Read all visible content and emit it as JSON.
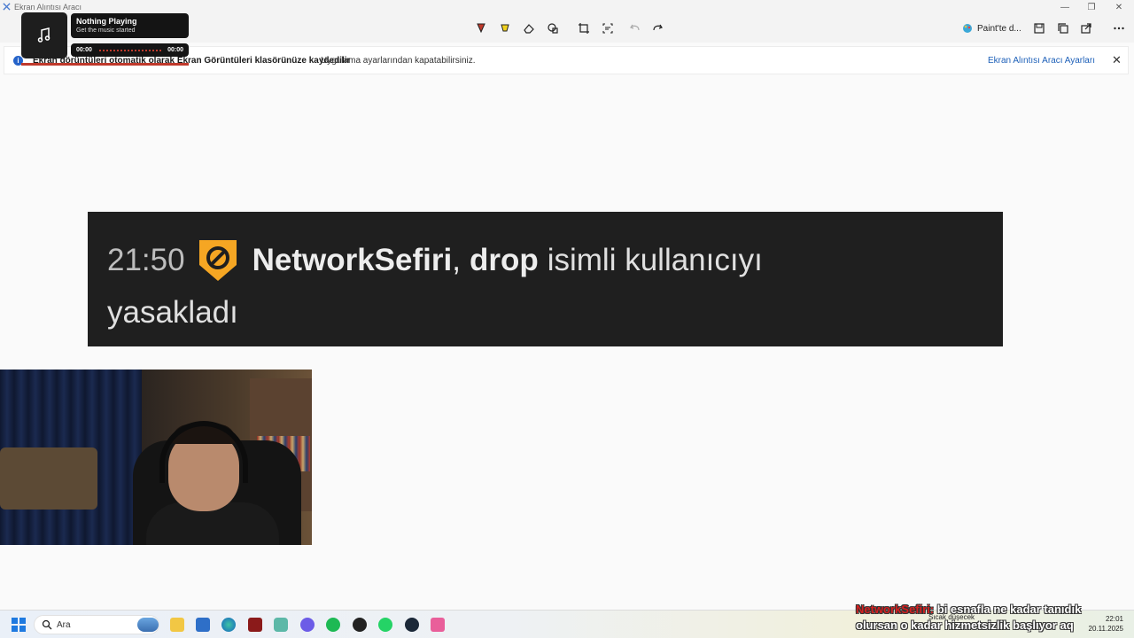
{
  "window": {
    "title": "Ekran Alıntısı Aracı",
    "controls": [
      "—",
      "❐",
      "✕"
    ]
  },
  "toolbar": {
    "tools": [
      "pen-icon",
      "highlighter-icon",
      "eraser-icon",
      "shapes-icon",
      "crop-icon",
      "text-actions-icon",
      "undo-icon",
      "redo-icon"
    ],
    "paint_label": "Paint'te d...",
    "actions": [
      "save-icon",
      "copy-icon",
      "share-icon",
      "more-icon"
    ]
  },
  "infobar": {
    "bold_text": "Ekran görüntüleri otomatik olarak Ekran Görüntüleri klasörünüze kaydedilir",
    "text": "Uygulama ayarlarından kapatabilirsiniz.",
    "link": "Ekran Alıntısı Aracı Ayarları",
    "close": "✕"
  },
  "music": {
    "title": "Nothing Playing",
    "subtitle": "Get the music started",
    "time_start": "00:00",
    "time_end": "00:00",
    "icon": "music-note-icon"
  },
  "chat_snippet": {
    "time": "21:50",
    "moderator": "NetworkSefiri",
    "comma": ",",
    "target": "drop",
    "message": "isimli kullanıcıyı",
    "message2": "yasakladı",
    "badge_color": "#f5a623"
  },
  "taskbar": {
    "search_placeholder": "Ara",
    "weather": "Sıcak düşecek",
    "clock_time": "22:01",
    "clock_date": "20.11.2025",
    "apps": [
      "weather-icon",
      "file-explorer-icon",
      "store-icon",
      "edge-icon",
      "news-app-icon",
      "network-icon",
      "discord-icon",
      "spotify-icon",
      "obs-icon",
      "whatsapp-icon",
      "steam-icon",
      "snipping-tool-icon"
    ]
  },
  "chat_overlay": {
    "user": "NetworkSefiri:",
    "line1": "bi esnafla ne kadar tanıdık",
    "line2": "olursan o kadar hizmetsizlik başlıyor aq"
  }
}
